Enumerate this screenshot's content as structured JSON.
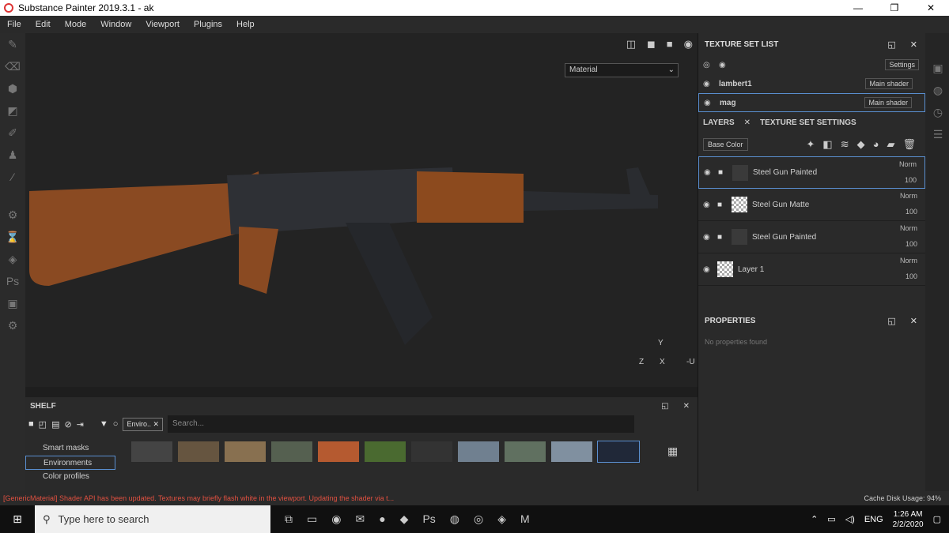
{
  "window": {
    "title": "Substance Painter 2019.3.1 - ak"
  },
  "menu": [
    "File",
    "Edit",
    "Mode",
    "Window",
    "Viewport",
    "Plugins",
    "Help"
  ],
  "viewport": {
    "material_select": "Material",
    "axis_labels": [
      "Y",
      "Z",
      "X",
      "-U"
    ]
  },
  "texture_set_list": {
    "header": "TEXTURE SET LIST",
    "settings_label": "Settings",
    "sets": [
      {
        "name": "lambert1",
        "shader": "Main shader"
      },
      {
        "name": "mag",
        "shader": "Main shader"
      }
    ]
  },
  "layers": {
    "tabs": [
      "LAYERS",
      "TEXTURE SET SETTINGS"
    ],
    "channel": "Base Color",
    "items": [
      {
        "name": "Steel Gun Painted",
        "blend": "Norm",
        "opacity": "100"
      },
      {
        "name": "Steel Gun Matte",
        "blend": "Norm",
        "opacity": "100"
      },
      {
        "name": "Steel Gun Painted",
        "blend": "Norm",
        "opacity": "100"
      },
      {
        "name": "Layer 1",
        "blend": "Norm",
        "opacity": "100"
      }
    ]
  },
  "properties": {
    "header": "PROPERTIES",
    "empty": "No properties found"
  },
  "shelf": {
    "header": "SHELF",
    "filter_tag": "Enviro..",
    "search_placeholder": "Search...",
    "categories": [
      "Smart masks",
      "Environments",
      "Color profiles"
    ]
  },
  "status": {
    "message": "[GenericMaterial] Shader API has been updated. Textures may briefly flash white in the viewport. Updating the shader via t...",
    "cache": "Cache Disk Usage:  94%"
  },
  "taskbar": {
    "search_placeholder": "Type here to search",
    "lang": "ENG",
    "time": "1:26 AM",
    "date": "2/2/2020"
  }
}
